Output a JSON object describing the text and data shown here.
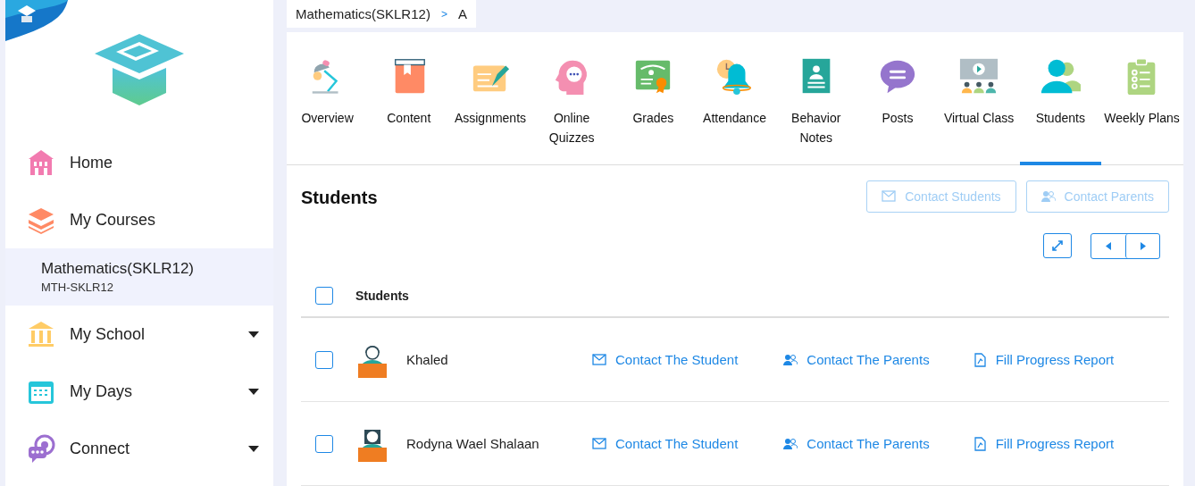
{
  "sidebar": {
    "items": [
      {
        "kind": "link",
        "label": "Home"
      },
      {
        "kind": "link",
        "label": "My Courses"
      },
      {
        "kind": "course",
        "label": "Mathematics(SKLR12)",
        "code": "MTH-SKLR12",
        "selected": true
      },
      {
        "kind": "menu",
        "label": "My School",
        "expanded": false
      },
      {
        "kind": "menu",
        "label": "My Days",
        "expanded": false
      },
      {
        "kind": "menu",
        "label": "Connect",
        "expanded": false
      }
    ]
  },
  "breadcrumb": {
    "items": [
      "Mathematics(SKLR12)",
      "A"
    ],
    "separator": ">"
  },
  "tabs": [
    {
      "label": "Overview",
      "selected": false
    },
    {
      "label": "Content",
      "selected": false
    },
    {
      "label": "Assignments",
      "selected": false
    },
    {
      "label": "Online Quizzes",
      "selected": false
    },
    {
      "label": "Grades",
      "selected": false
    },
    {
      "label": "Attendance",
      "selected": false
    },
    {
      "label": "Behavior Notes",
      "selected": false
    },
    {
      "label": "Posts",
      "selected": false
    },
    {
      "label": "Virtual Class",
      "selected": false
    },
    {
      "label": "Students",
      "selected": true
    },
    {
      "label": "Weekly Plans",
      "selected": false
    }
  ],
  "panel": {
    "title": "Students",
    "buttons": [
      {
        "label": "Contact Students",
        "kind": "mail",
        "disabled": true
      },
      {
        "label": "Contact Parents",
        "kind": "parents",
        "disabled": true
      }
    ],
    "table": {
      "header": {
        "label": "Students",
        "checked": false
      },
      "rows": [
        {
          "name": "Khaled",
          "checked": false,
          "avatar": {
            "kind": "boy"
          },
          "actions": [
            {
              "kind": "mail",
              "label": "Contact The Student"
            },
            {
              "kind": "parents",
              "label": "Contact The Parents"
            },
            {
              "kind": "report",
              "label": "Fill Progress Report"
            }
          ]
        },
        {
          "name": "Rodyna Wael Shalaan",
          "checked": false,
          "avatar": {
            "kind": "girl"
          },
          "actions": [
            {
              "kind": "mail",
              "label": "Contact The Student"
            },
            {
              "kind": "parents",
              "label": "Contact The Parents"
            },
            {
              "kind": "report",
              "label": "Fill Progress Report"
            }
          ]
        }
      ]
    }
  }
}
